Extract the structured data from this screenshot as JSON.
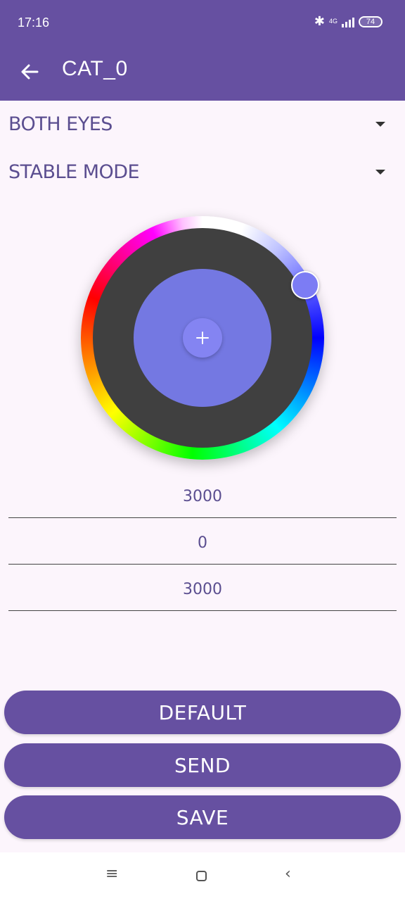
{
  "status_bar": {
    "time": "17:16",
    "network": "4G",
    "battery": "74"
  },
  "app_bar": {
    "title": "CAT_0",
    "back_icon": "arrow-left-icon"
  },
  "dropdowns": [
    {
      "value": "BOTH EYES"
    },
    {
      "value": "STABLE MODE"
    }
  ],
  "color_picker": {
    "selected_color": "#7478e2",
    "add_icon": "plus-icon"
  },
  "fields": [
    {
      "value": "3000"
    },
    {
      "value": "0"
    },
    {
      "value": "3000"
    }
  ],
  "buttons": {
    "default_label": "DEFAULT",
    "send_label": "SEND",
    "save_label": "SAVE"
  },
  "colors": {
    "primary": "#6650a1",
    "background": "#fcf5fc",
    "text": "#5b4e90"
  }
}
